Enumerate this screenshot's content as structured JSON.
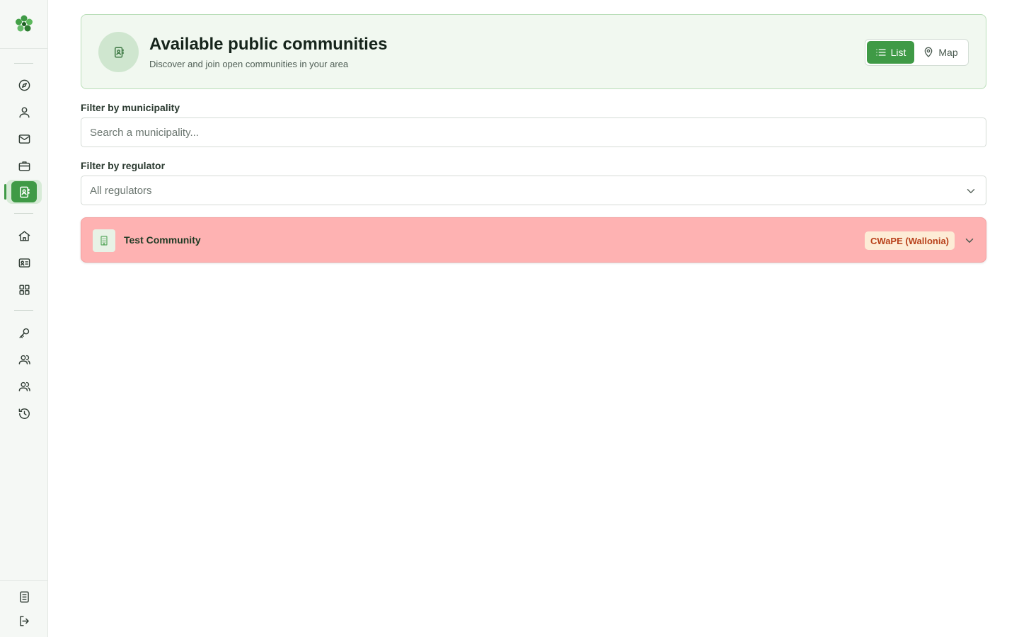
{
  "header": {
    "title": "Available public communities",
    "subtitle": "Discover and join open communities in your area"
  },
  "view_toggle": {
    "list_label": "List",
    "map_label": "Map",
    "selected": "List"
  },
  "filters": {
    "municipality": {
      "label": "Filter by municipality",
      "placeholder": "Search a municipality...",
      "value": ""
    },
    "regulator": {
      "label": "Filter by regulator",
      "selected": "All regulators"
    }
  },
  "communities": [
    {
      "name": "Test Community",
      "regulator": "CWaPE (Wallonia)"
    }
  ],
  "sidebar": {
    "active_item": "communities",
    "items": [
      "explore-icon",
      "user-icon",
      "mail-icon",
      "briefcase-icon",
      "contact-book-icon",
      "home-icon",
      "id-card-icon",
      "grid-icon",
      "key-icon",
      "users-icon",
      "team-icon",
      "history-icon",
      "document-icon",
      "logout-icon"
    ]
  },
  "colors": {
    "brand": "#3f9a46",
    "header_bg": "#f1f8f0",
    "row_highlight": "#feb2b2",
    "badge_bg": "#fdecd6",
    "badge_text": "#b8401a"
  }
}
